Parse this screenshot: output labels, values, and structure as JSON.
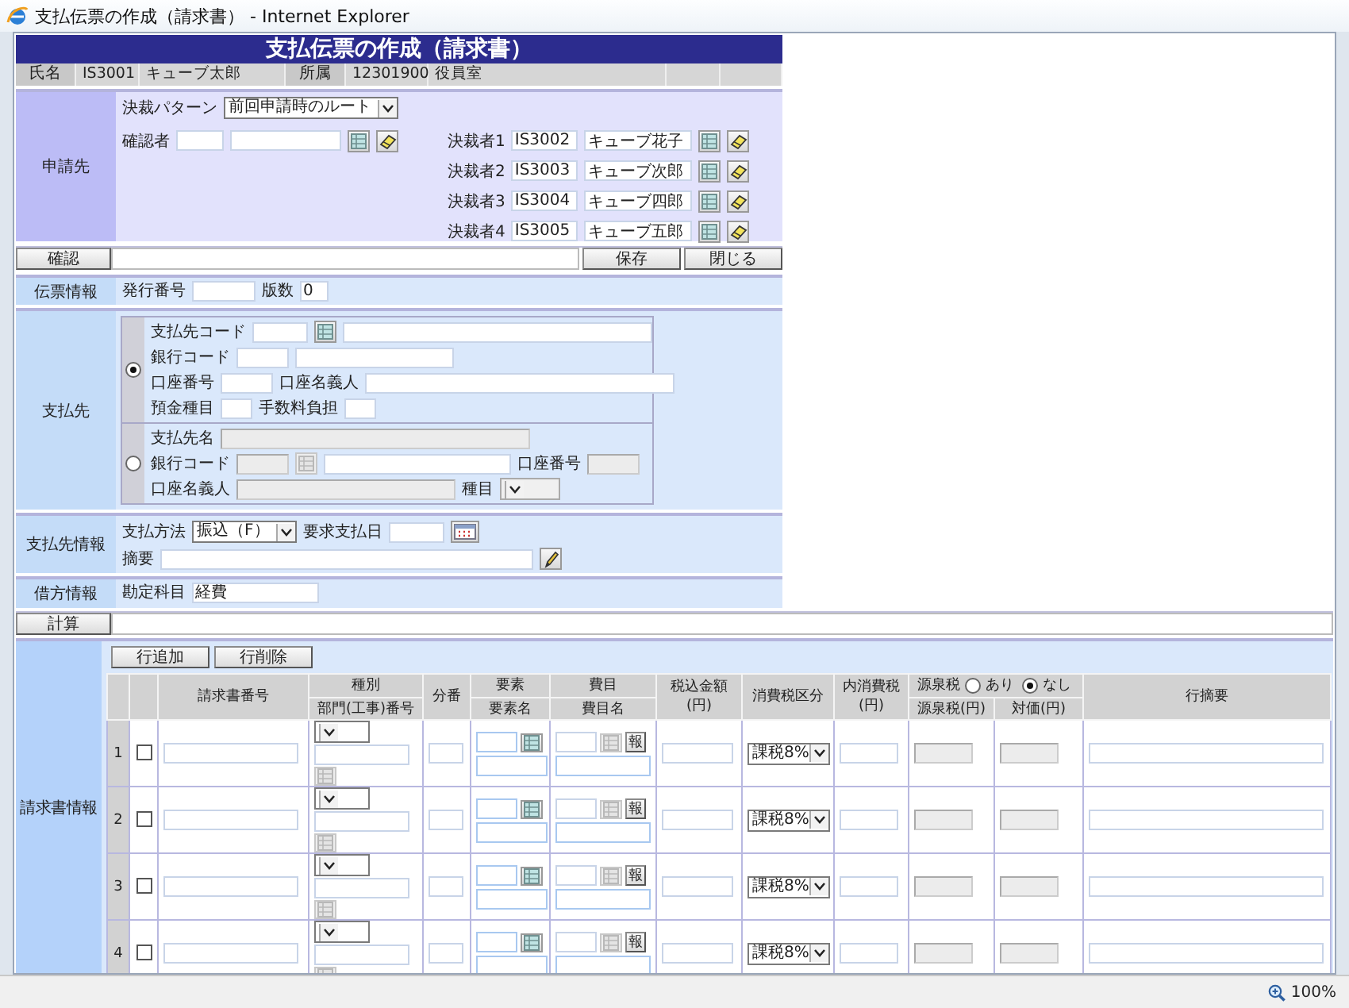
{
  "window": {
    "title": "支払伝票の作成（請求書） - Internet Explorer"
  },
  "header": {
    "title": "支払伝票の作成（請求書）"
  },
  "user_bar": {
    "name_label": "氏名",
    "user_code": "IS3001",
    "user_name": "キューブ太郎",
    "dept_label": "所属",
    "dept_code": "12301900",
    "dept_name": "役員室"
  },
  "applicant": {
    "label": "申請先",
    "pattern_label": "決裁パターン",
    "pattern_value": "前回申請時のルート",
    "checker_label": "確認者",
    "approvers": [
      {
        "label": "決裁者1",
        "code": "IS3002",
        "name": "キューブ花子"
      },
      {
        "label": "決裁者2",
        "code": "IS3003",
        "name": "キューブ次郎"
      },
      {
        "label": "決裁者3",
        "code": "IS3004",
        "name": "キューブ四郎"
      },
      {
        "label": "決裁者4",
        "code": "IS3005",
        "name": "キューブ五郎"
      }
    ]
  },
  "actions": {
    "confirm": "確認",
    "save": "保存",
    "close": "閉じる"
  },
  "slip": {
    "label": "伝票情報",
    "issue_no_label": "発行番号",
    "version_label": "版数",
    "version_value": "0"
  },
  "payee": {
    "label": "支払先",
    "options": [
      {
        "kind": "registered",
        "selected": true,
        "code_label": "支払先コード",
        "bank_label": "銀行コード",
        "account_no_label": "口座番号",
        "holder_label": "口座名義人",
        "deposit_type_label": "預金種目",
        "fee_label": "手数料負担"
      },
      {
        "kind": "manual",
        "selected": false,
        "name_label": "支払先名",
        "bank_label": "銀行コード",
        "account_no_label": "口座番号",
        "holder_label": "口座名義人",
        "type_label": "種目"
      }
    ]
  },
  "payee_info": {
    "label": "支払先情報",
    "method_label": "支払方法",
    "method_value": "振込（F）",
    "date_label": "要求支払日",
    "summary_label": "摘要"
  },
  "debit": {
    "label": "借方情報",
    "account_label": "勘定科目",
    "account_value": "経費"
  },
  "calc": {
    "button": "計算"
  },
  "invoice": {
    "label": "請求書情報",
    "add_row": "行追加",
    "delete_row": "行削除",
    "columns": [
      {
        "kind": "single",
        "title": "請求書番号"
      },
      {
        "kind": "stacked",
        "title": "種別",
        "subtitle": "部門(工事)番号"
      },
      {
        "kind": "single",
        "title": "分番"
      },
      {
        "kind": "stacked",
        "title": "要素",
        "subtitle": "要素名"
      },
      {
        "kind": "stacked",
        "title": "費目",
        "subtitle": "費目名"
      },
      {
        "kind": "single",
        "title": "税込金額(円)"
      },
      {
        "kind": "single",
        "title": "消費税区分"
      },
      {
        "kind": "single",
        "title": "内消費税(円)"
      },
      {
        "kind": "withholding",
        "title": "源泉税",
        "options": [
          {
            "label": "あり",
            "selected": false
          },
          {
            "label": "なし",
            "selected": true
          }
        ],
        "subtitles": [
          "源泉税(円)",
          "対価(円)"
        ]
      },
      {
        "kind": "single",
        "title": "行摘要"
      }
    ],
    "rows": [
      {
        "number": "1",
        "checked": false,
        "tax_type": "課税8%",
        "detail_button": "報"
      },
      {
        "number": "2",
        "checked": false,
        "tax_type": "課税8%",
        "detail_button": "報"
      },
      {
        "number": "3",
        "checked": false,
        "tax_type": "課税8%",
        "detail_button": "報"
      },
      {
        "number": "4",
        "checked": false,
        "tax_type": "課税8%",
        "detail_button": "報"
      }
    ]
  },
  "status_bar": {
    "zoom": "100%"
  }
}
